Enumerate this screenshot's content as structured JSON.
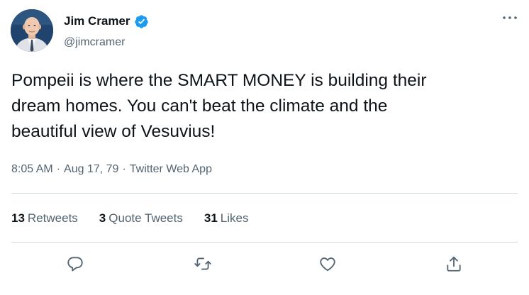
{
  "author": {
    "display_name": "Jim Cramer",
    "handle": "@jimcramer",
    "verified": true
  },
  "tweet": {
    "text": "Pompeii is where the SMART MONEY is building their\ndream homes. You can't beat the climate and the\nbeautiful view of Vesuvius!",
    "time": "8:05 AM",
    "separator_1": "·",
    "date": "Aug 17, 79",
    "separator_2": "·",
    "source": "Twitter Web App"
  },
  "stats": {
    "retweets_count": "13",
    "retweets_label": "Retweets",
    "quotes_count": "3",
    "quotes_label": "Quote Tweets",
    "likes_count": "31",
    "likes_label": "Likes"
  },
  "icons": {
    "more": "more-icon",
    "verified": "verified-badge-icon",
    "reply": "reply-icon",
    "retweet": "retweet-icon",
    "like": "like-icon",
    "share": "share-icon"
  },
  "colors": {
    "text_primary": "#0f1419",
    "text_secondary": "#536471",
    "verified_blue": "#1d9bf0",
    "divider": "#cfd9de"
  }
}
